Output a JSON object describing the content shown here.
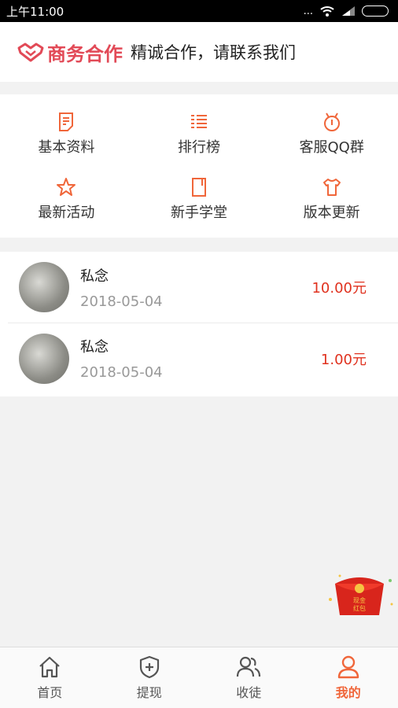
{
  "status_bar": {
    "time": "上午11:00",
    "signal_dots": "...",
    "wifi_icon": "wifi-icon",
    "signal_icon": "signal-icon",
    "battery_icon": "battery-icon"
  },
  "banner": {
    "logo_text": "商务合作",
    "text": "精诚合作，请联系我们"
  },
  "menu": [
    {
      "label": "基本资料",
      "icon": "document-icon"
    },
    {
      "label": "排行榜",
      "icon": "ranking-icon"
    },
    {
      "label": "客服QQ群",
      "icon": "qq-group-icon"
    },
    {
      "label": "最新活动",
      "icon": "star-icon"
    },
    {
      "label": "新手学堂",
      "icon": "book-icon"
    },
    {
      "label": "版本更新",
      "icon": "shirt-icon"
    }
  ],
  "records": [
    {
      "name": "私念",
      "date": "2018-05-04",
      "amount": "10.00元"
    },
    {
      "name": "私念",
      "date": "2018-05-04",
      "amount": "1.00元"
    }
  ],
  "red_envelope": {
    "text_line1": "现金",
    "text_line2": "红包"
  },
  "tabbar": [
    {
      "label": "首页",
      "icon": "home-icon",
      "active": false
    },
    {
      "label": "提现",
      "icon": "withdraw-shield-icon",
      "active": false
    },
    {
      "label": "收徒",
      "icon": "users-icon",
      "active": false
    },
    {
      "label": "我的",
      "icon": "profile-icon",
      "active": true
    }
  ],
  "colors": {
    "accent": "#f0663a",
    "amount": "#e0321f",
    "logo": "#e24a57"
  }
}
